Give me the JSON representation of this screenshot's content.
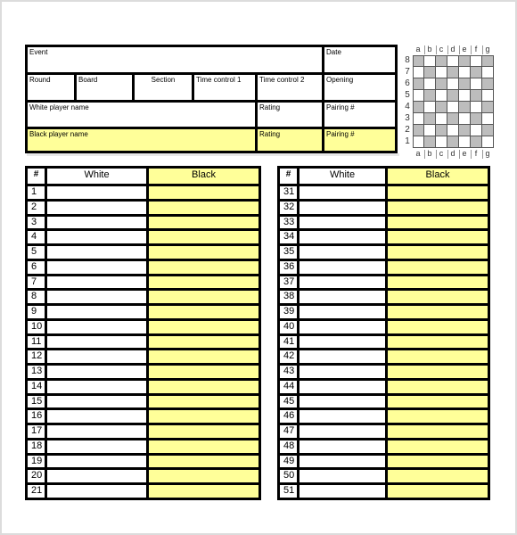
{
  "header_form": {
    "event_label": "Event",
    "date_label": "Date",
    "round_label": "Round",
    "board_label": "Board",
    "section_label": "Section",
    "time_control_1_label": "Time control 1",
    "time_control_2_label": "Time control 2",
    "opening_label": "Opening",
    "white_player_label": "White player name",
    "white_rating_label": "Rating",
    "white_pairing_label": "Pairing #",
    "black_player_label": "Black player name",
    "black_rating_label": "Rating",
    "black_pairing_label": "Pairing #"
  },
  "chessboard": {
    "files": [
      "a",
      "b",
      "c",
      "d",
      "e",
      "f",
      "g"
    ],
    "ranks": [
      "8",
      "7",
      "6",
      "5",
      "4",
      "3",
      "2",
      "1"
    ]
  },
  "move_tables": [
    {
      "headers": {
        "number": "#",
        "white": "White",
        "black": "Black"
      },
      "move_numbers": [
        "1",
        "2",
        "3",
        "4",
        "5",
        "6",
        "7",
        "8",
        "9",
        "10",
        "11",
        "12",
        "13",
        "14",
        "15",
        "16",
        "17",
        "18",
        "19",
        "20",
        "21"
      ]
    },
    {
      "headers": {
        "number": "#",
        "white": "White",
        "black": "Black"
      },
      "move_numbers": [
        "31",
        "32",
        "33",
        "34",
        "35",
        "36",
        "37",
        "38",
        "39",
        "40",
        "41",
        "42",
        "43",
        "44",
        "45",
        "46",
        "47",
        "48",
        "49",
        "50",
        "51"
      ]
    }
  ],
  "colors": {
    "black_side_fill": "#ffff99",
    "dark_square": "#bdbdbd",
    "border": "#000000"
  }
}
